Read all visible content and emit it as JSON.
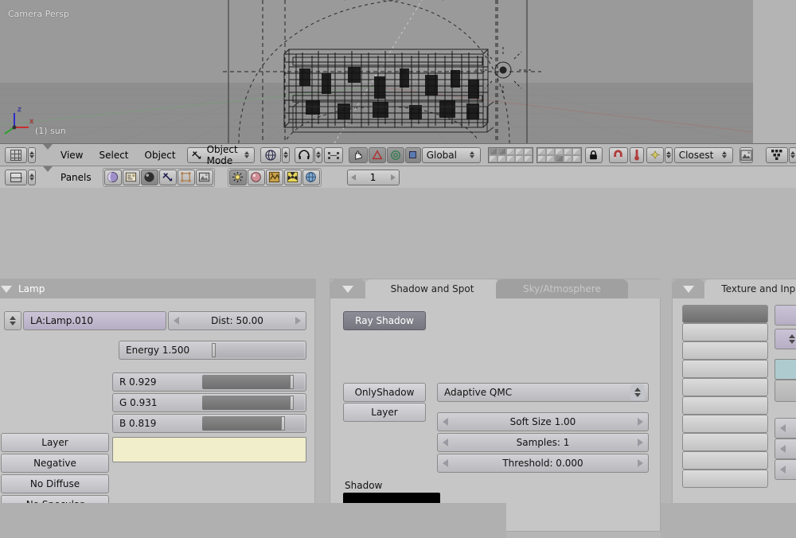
{
  "viewport": {
    "view_label": "Camera Persp",
    "object_label": "(1) sun",
    "axis_z": "z",
    "axis_x": "x"
  },
  "header_3dview": {
    "editor_icon": "grid-icon",
    "menus": [
      "View",
      "Select",
      "Object"
    ],
    "mode_selector": {
      "label": "Object Mode",
      "icon": "object-mode-icon"
    },
    "draw_type_icon": "wireframe-draw-type-icon",
    "pivot_icon": "pivot-median-icon",
    "manipulator_icons": [
      "hand-icon",
      "rotate-manipulator-icon",
      "scale-manipulator-icon"
    ],
    "orientation": "Global",
    "layers": {
      "top_row": [
        true,
        true,
        false,
        false,
        false,
        false,
        false,
        false,
        false,
        false
      ],
      "bottom_row": [
        false,
        false,
        false,
        false,
        false,
        false,
        false,
        true,
        false,
        false
      ]
    },
    "lock_icon": "lock-icon",
    "snap_icon": "magnet-icon",
    "snap_mode_icon": "snap-element-icon",
    "snap_target": "Closest",
    "render_icon": "render-image-icon",
    "outliner_icon": "outliner-grid-icon"
  },
  "header_buttons": {
    "editor_icon": "buttons-window-icon",
    "label": "Panels",
    "context_icons": [
      "logic-icon",
      "script-icon",
      "shading-icon",
      "object-icon",
      "editing-icon",
      "scene-icon"
    ],
    "shading_icons": [
      "lamp-icon",
      "material-icon",
      "texture-icon",
      "radiosity-icon",
      "world-icon"
    ],
    "frame": "1"
  },
  "lamp_panel": {
    "title": "Lamp",
    "name_field": "LA:Lamp.010",
    "dist": "Dist: 50.00",
    "energy": {
      "label": "Energy 1.500",
      "value": 1.5,
      "max": 10,
      "fill_pct": 6
    },
    "color": [
      {
        "label": "R 0.929",
        "value": 0.929
      },
      {
        "label": "G 0.931",
        "value": 0.931
      },
      {
        "label": "B 0.819",
        "value": 0.819
      }
    ],
    "color_swatch": "#f0eecb",
    "toggles": [
      "Layer",
      "Negative",
      "No Diffuse",
      "No Specular"
    ]
  },
  "shadow_panel": {
    "tabs": [
      {
        "label": "Shadow and Spot",
        "active": true
      },
      {
        "label": "Sky/Atmosphere",
        "active": false
      }
    ],
    "ray_shadow": "Ray Shadow",
    "only_shadow": "OnlyShadow",
    "layer": "Layer",
    "sampling_method": "Adaptive QMC",
    "soft_size": "Soft Size 1.00",
    "samples": "Samples: 1",
    "threshold": "Threshold: 0.000",
    "shadow_label": "Shadow",
    "shadow_color": "#000000"
  },
  "texture_panel": {
    "title": "Texture and Input",
    "slots": 10,
    "selected_slot": 0,
    "texture_name_field": "",
    "browse_icon": "browse-datablock-icon",
    "map_input_swatch": "#aeccd0"
  }
}
